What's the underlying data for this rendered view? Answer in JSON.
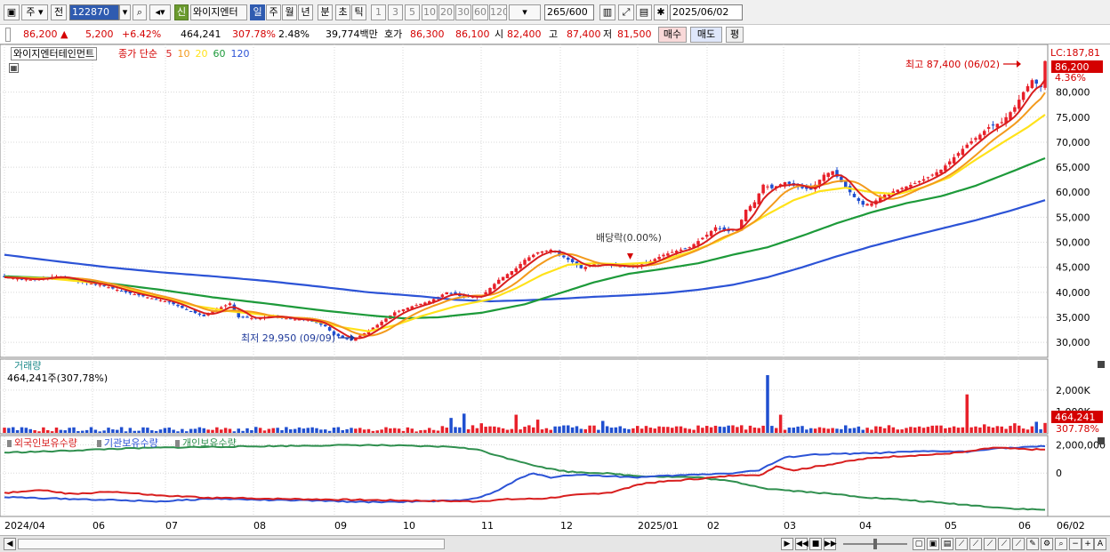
{
  "toolbar": {
    "market_label": "주",
    "prev_label": "전",
    "code": "122870",
    "new_badge": "신",
    "stock_short": "와이지엔터",
    "periods": [
      "일",
      "주",
      "월",
      "년",
      "분",
      "초",
      "틱"
    ],
    "intervals": [
      "1",
      "3",
      "5",
      "10",
      "20",
      "30",
      "60",
      "120"
    ],
    "count_value": "265",
    "count_total": "/600",
    "date": "2025/06/02"
  },
  "quote": {
    "price": "86,200",
    "change": "5,200",
    "change_pct": "+6.42%",
    "volume": "464,241",
    "volume_pct": "307.78%",
    "turnover_pct": "2.48%",
    "amount": "39,774백만",
    "bid_label": "호가",
    "ask_price": "86,300",
    "bid_price": "86,100",
    "open_label": "시",
    "open": "82,400",
    "high_label": "고",
    "high": "87,400",
    "low_label": "저",
    "low": "81,500",
    "buy_label": "매수",
    "sell_label": "매도",
    "eval_label": "평"
  },
  "chart_data": {
    "type": "candlestick",
    "title": "와이지엔터테인먼트",
    "price_legend": {
      "label": "종가 단순",
      "ma_periods": [
        "5",
        "10",
        "20",
        "60",
        "120"
      ]
    },
    "colors": {
      "up": "#e8202a",
      "down": "#1f4fd0",
      "ma5": "#d81e1e",
      "ma10": "#f39a1c",
      "ma20": "#ffe21a",
      "ma60": "#1d9a3a",
      "ma120": "#2c53d6",
      "foreign": "#d81e1e",
      "institution": "#2c53d6",
      "individual": "#2f8f4e"
    },
    "price_axis": {
      "ticks": [
        "30,000",
        "35,000",
        "40,000",
        "45,000",
        "50,000",
        "55,000",
        "60,000",
        "65,000",
        "70,000",
        "75,000",
        "80,000"
      ],
      "range": [
        27000,
        89000
      ]
    },
    "lc_label": "LC:187,81",
    "current_price_label": "86,200",
    "current_change_label": "4.36%",
    "high_annotation": "최고 87,400 (06/02)",
    "low_annotation": "최저 29,950 (09/09)",
    "dividend_annotation": "배당락(0.00%)",
    "x_labels": [
      "2024/04",
      "06",
      "07",
      "08",
      "09",
      "10",
      "11",
      "12",
      "2025/01",
      "02",
      "03",
      "04",
      "05",
      "06",
      "06/02"
    ],
    "price_series": {
      "close": [
        [
          0,
          43000
        ],
        [
          6,
          42500
        ],
        [
          12,
          43200
        ],
        [
          18,
          42000
        ],
        [
          22,
          41500
        ],
        [
          28,
          40000
        ],
        [
          34,
          38800
        ],
        [
          38,
          38000
        ],
        [
          42,
          36500
        ],
        [
          46,
          35200
        ],
        [
          48,
          36200
        ],
        [
          52,
          37800
        ],
        [
          54,
          35000
        ],
        [
          58,
          34800
        ],
        [
          62,
          35300
        ],
        [
          66,
          34600
        ],
        [
          70,
          34500
        ],
        [
          74,
          33200
        ],
        [
          76,
          31500
        ],
        [
          80,
          30400
        ],
        [
          83,
          31800
        ],
        [
          86,
          33500
        ],
        [
          90,
          36000
        ],
        [
          94,
          37200
        ],
        [
          98,
          38200
        ],
        [
          102,
          40000
        ],
        [
          106,
          39000
        ],
        [
          110,
          39200
        ],
        [
          114,
          42500
        ],
        [
          118,
          44800
        ],
        [
          120,
          46500
        ],
        [
          123,
          48000
        ],
        [
          126,
          48500
        ],
        [
          128,
          47500
        ],
        [
          131,
          46000
        ],
        [
          133,
          44800
        ],
        [
          136,
          45600
        ],
        [
          140,
          45400
        ],
        [
          144,
          45000
        ],
        [
          148,
          45800
        ],
        [
          152,
          47500
        ],
        [
          155,
          48300
        ],
        [
          158,
          49000
        ],
        [
          162,
          51500
        ],
        [
          164,
          53000
        ],
        [
          167,
          52200
        ],
        [
          169,
          52500
        ],
        [
          171,
          56500
        ],
        [
          173,
          58000
        ],
        [
          175,
          61500
        ],
        [
          177,
          60800
        ],
        [
          180,
          62000
        ],
        [
          183,
          61000
        ],
        [
          186,
          60500
        ],
        [
          189,
          63500
        ],
        [
          191,
          64200
        ],
        [
          193,
          62000
        ],
        [
          196,
          59000
        ],
        [
          198,
          57500
        ],
        [
          200,
          57800
        ],
        [
          203,
          59500
        ],
        [
          206,
          60500
        ],
        [
          210,
          61800
        ],
        [
          213,
          63000
        ],
        [
          216,
          64500
        ],
        [
          219,
          67000
        ],
        [
          222,
          69500
        ],
        [
          225,
          71500
        ],
        [
          227,
          73000
        ],
        [
          230,
          74000
        ],
        [
          233,
          77000
        ],
        [
          235,
          80000
        ],
        [
          237,
          82400
        ],
        [
          239,
          81000
        ],
        [
          240,
          86200
        ]
      ],
      "ma20": [
        [
          0,
          43000
        ],
        [
          10,
          42800
        ],
        [
          22,
          41800
        ],
        [
          34,
          39500
        ],
        [
          44,
          37300
        ],
        [
          52,
          36200
        ],
        [
          60,
          35500
        ],
        [
          70,
          34600
        ],
        [
          78,
          33000
        ],
        [
          84,
          32200
        ],
        [
          90,
          33400
        ],
        [
          96,
          35200
        ],
        [
          104,
          37200
        ],
        [
          112,
          38600
        ],
        [
          118,
          40800
        ],
        [
          124,
          43500
        ],
        [
          130,
          45500
        ],
        [
          136,
          45800
        ],
        [
          142,
          45600
        ],
        [
          150,
          46000
        ],
        [
          158,
          48000
        ],
        [
          164,
          50000
        ],
        [
          170,
          52500
        ],
        [
          176,
          55600
        ],
        [
          182,
          58400
        ],
        [
          188,
          60200
        ],
        [
          194,
          60900
        ],
        [
          200,
          60000
        ],
        [
          206,
          59600
        ],
        [
          212,
          61000
        ],
        [
          218,
          63000
        ],
        [
          224,
          66500
        ],
        [
          230,
          69800
        ],
        [
          236,
          73000
        ],
        [
          240,
          75500
        ]
      ],
      "ma60": [
        [
          0,
          43200
        ],
        [
          12,
          42800
        ],
        [
          24,
          41800
        ],
        [
          36,
          40500
        ],
        [
          48,
          39000
        ],
        [
          60,
          37800
        ],
        [
          72,
          36500
        ],
        [
          84,
          35400
        ],
        [
          92,
          34800
        ],
        [
          100,
          35000
        ],
        [
          110,
          35900
        ],
        [
          120,
          37600
        ],
        [
          128,
          39800
        ],
        [
          136,
          42000
        ],
        [
          144,
          43700
        ],
        [
          152,
          44700
        ],
        [
          160,
          45800
        ],
        [
          168,
          47500
        ],
        [
          176,
          49000
        ],
        [
          184,
          51300
        ],
        [
          192,
          53800
        ],
        [
          200,
          56000
        ],
        [
          208,
          57800
        ],
        [
          216,
          59200
        ],
        [
          224,
          61300
        ],
        [
          232,
          64000
        ],
        [
          240,
          66800
        ]
      ],
      "ma120": [
        [
          0,
          47500
        ],
        [
          12,
          46200
        ],
        [
          24,
          45000
        ],
        [
          36,
          44000
        ],
        [
          48,
          43200
        ],
        [
          60,
          42300
        ],
        [
          72,
          41200
        ],
        [
          84,
          40000
        ],
        [
          96,
          39200
        ],
        [
          104,
          38500
        ],
        [
          112,
          38200
        ],
        [
          120,
          38400
        ],
        [
          128,
          38700
        ],
        [
          136,
          39100
        ],
        [
          144,
          39400
        ],
        [
          152,
          39800
        ],
        [
          160,
          40500
        ],
        [
          168,
          41500
        ],
        [
          176,
          43000
        ],
        [
          184,
          45000
        ],
        [
          192,
          47200
        ],
        [
          200,
          49200
        ],
        [
          208,
          51000
        ],
        [
          216,
          52700
        ],
        [
          224,
          54400
        ],
        [
          232,
          56300
        ],
        [
          240,
          58400
        ]
      ]
    },
    "volume_panel": {
      "label": "거래량",
      "value_label": "464,241주(307,78%)",
      "axis_ticks": [
        "1,000K",
        "2,000K"
      ],
      "range": [
        0,
        3200000
      ],
      "current_label": "464,241",
      "current_pct_label": "307.78%",
      "spikes": [
        [
          103,
          700000
        ],
        [
          106,
          900000
        ],
        [
          110,
          450000
        ],
        [
          118,
          850000
        ],
        [
          123,
          620000
        ],
        [
          138,
          560000
        ],
        [
          176,
          2700000
        ],
        [
          179,
          850000
        ],
        [
          222,
          1800000
        ],
        [
          226,
          400000
        ],
        [
          233,
          450000
        ],
        [
          238,
          520000
        ],
        [
          240,
          464241
        ]
      ]
    },
    "holdings_panel": {
      "legend": [
        "외국인보유수량",
        "기관보유수량",
        "개인보유수량"
      ],
      "axis_ticks": [
        "0",
        "2,000,000"
      ],
      "range": [
        -3000000,
        2400000
      ],
      "foreign": [
        [
          0,
          -1400000
        ],
        [
          8,
          -1200000
        ],
        [
          16,
          -1500000
        ],
        [
          24,
          -1300000
        ],
        [
          36,
          -1600000
        ],
        [
          48,
          -1750000
        ],
        [
          60,
          -1800000
        ],
        [
          72,
          -1850000
        ],
        [
          84,
          -1900000
        ],
        [
          96,
          -1950000
        ],
        [
          108,
          -2000000
        ],
        [
          116,
          -1850000
        ],
        [
          124,
          -1800000
        ],
        [
          132,
          -1550000
        ],
        [
          140,
          -1350000
        ],
        [
          148,
          -700000
        ],
        [
          156,
          -500000
        ],
        [
          164,
          -300000
        ],
        [
          170,
          -100000
        ],
        [
          174,
          -200000
        ],
        [
          178,
          500000
        ],
        [
          182,
          200000
        ],
        [
          190,
          600000
        ],
        [
          198,
          1000000
        ],
        [
          206,
          1200000
        ],
        [
          214,
          1300000
        ],
        [
          222,
          1500000
        ],
        [
          228,
          1800000
        ],
        [
          234,
          1700000
        ],
        [
          240,
          1650000
        ]
      ],
      "institution": [
        [
          0,
          -1700000
        ],
        [
          12,
          -1800000
        ],
        [
          24,
          -1900000
        ],
        [
          36,
          -2000000
        ],
        [
          48,
          -1800000
        ],
        [
          60,
          -1900000
        ],
        [
          72,
          -1950000
        ],
        [
          84,
          -2050000
        ],
        [
          96,
          -2000000
        ],
        [
          104,
          -1950000
        ],
        [
          110,
          -1700000
        ],
        [
          114,
          -1200000
        ],
        [
          118,
          -500000
        ],
        [
          122,
          0
        ],
        [
          126,
          -300000
        ],
        [
          132,
          -100000
        ],
        [
          138,
          -200000
        ],
        [
          146,
          -300000
        ],
        [
          152,
          -200000
        ],
        [
          160,
          -100000
        ],
        [
          168,
          0
        ],
        [
          174,
          200000
        ],
        [
          180,
          1100000
        ],
        [
          186,
          1300000
        ],
        [
          192,
          1350000
        ],
        [
          200,
          1400000
        ],
        [
          208,
          1500000
        ],
        [
          216,
          1550000
        ],
        [
          222,
          1500000
        ],
        [
          228,
          1750000
        ],
        [
          234,
          1800000
        ],
        [
          240,
          1900000
        ]
      ],
      "individual": [
        [
          0,
          1450000
        ],
        [
          12,
          1550000
        ],
        [
          24,
          1700000
        ],
        [
          36,
          1800000
        ],
        [
          48,
          1850000
        ],
        [
          60,
          1900000
        ],
        [
          72,
          1950000
        ],
        [
          84,
          1980000
        ],
        [
          96,
          1900000
        ],
        [
          104,
          1850000
        ],
        [
          110,
          1600000
        ],
        [
          114,
          1200000
        ],
        [
          118,
          900000
        ],
        [
          124,
          400000
        ],
        [
          130,
          100000
        ],
        [
          138,
          0
        ],
        [
          146,
          -200000
        ],
        [
          152,
          -250000
        ],
        [
          160,
          -300000
        ],
        [
          168,
          -600000
        ],
        [
          176,
          -1100000
        ],
        [
          184,
          -1300000
        ],
        [
          192,
          -1500000
        ],
        [
          200,
          -1750000
        ],
        [
          208,
          -1900000
        ],
        [
          216,
          -2100000
        ],
        [
          224,
          -2300000
        ],
        [
          232,
          -2500000
        ],
        [
          240,
          -2600000
        ]
      ]
    },
    "n_points": 241
  }
}
